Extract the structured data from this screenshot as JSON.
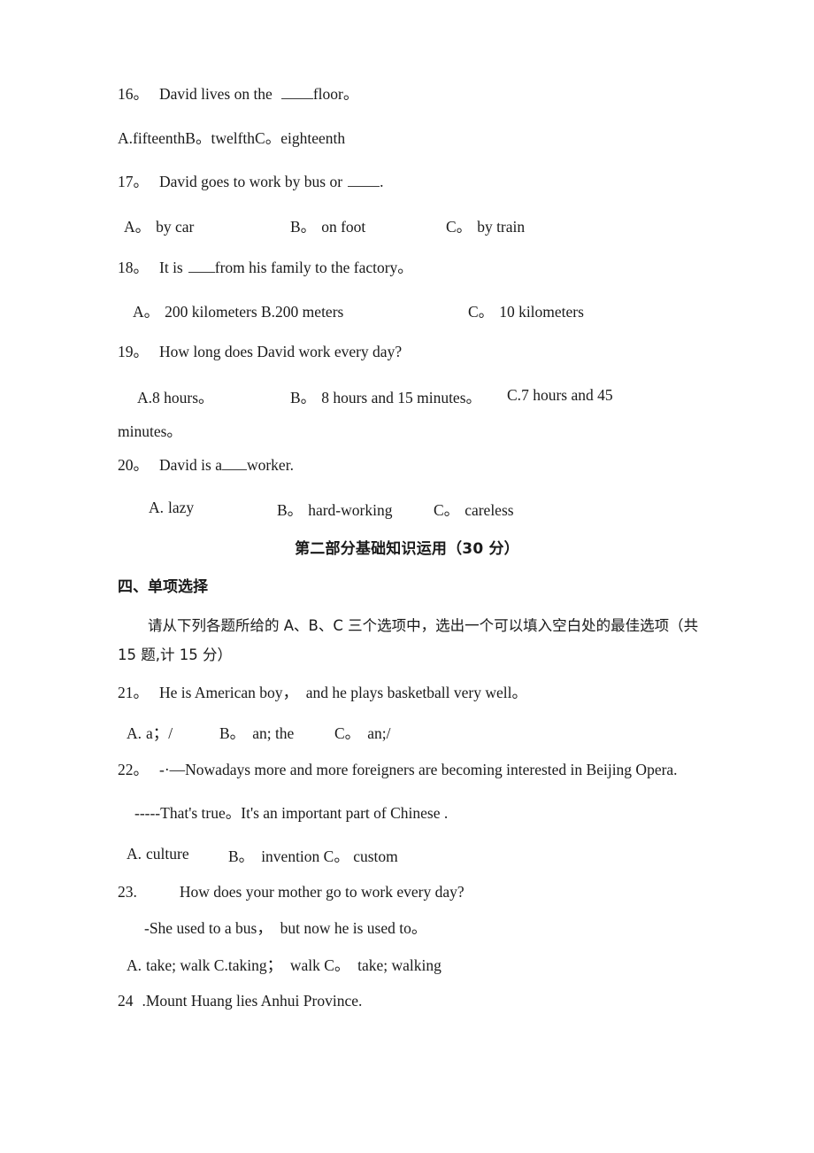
{
  "document": {
    "type": "exam-paper",
    "language": "en-zh",
    "page_background": "#ffffff",
    "text_color": "#1a1a1a"
  },
  "questions": [
    {
      "number": "16。",
      "stem_pre": "David lives on the",
      "stem_post": "floor。",
      "options_raw": "A.fifteenthB。twelfthC。eighteenth",
      "options": [
        {
          "label": "A.",
          "text": "fifteenth"
        },
        {
          "label": "B。",
          "text": "twelfth"
        },
        {
          "label": "C。",
          "text": "eighteenth"
        }
      ]
    },
    {
      "number": "17。",
      "stem_pre": "David goes to work by bus or",
      "stem_post": ".",
      "options": [
        {
          "label": "A。",
          "text": "by car"
        },
        {
          "label": "B。",
          "text": "on foot"
        },
        {
          "label": "C。",
          "text": "by train"
        }
      ]
    },
    {
      "number": "18。",
      "stem_pre": "It is",
      "stem_post": "from his family to the factory。",
      "options": [
        {
          "label": "A。",
          "text": "200 kilometers B.200 meters"
        },
        {
          "label": "C。",
          "text": "10 kilometers"
        }
      ]
    },
    {
      "number": "19。",
      "stem": "How long does David work every day?",
      "options": [
        {
          "label": "A.",
          "text": "8 hours。"
        },
        {
          "label": "B。",
          "text": "8 hours and 15 minutes。"
        },
        {
          "label": "C.",
          "text": "7 hours and 45"
        }
      ],
      "options_wrap": "minutes。"
    },
    {
      "number": "20。",
      "stem_pre": "David is a",
      "stem_post": "worker.",
      "options": [
        {
          "label": "A.",
          "text": "lazy"
        },
        {
          "label": "B。",
          "text": "hard-working"
        },
        {
          "label": "C。",
          "text": "careless"
        }
      ]
    },
    {
      "number": "21。",
      "stem": "He is American boy，  and he plays basketball very well。",
      "options": [
        {
          "label": "A.",
          "text": "a；/"
        },
        {
          "label": "B。",
          "text": "an; the"
        },
        {
          "label": "C。",
          "text": "an;/"
        }
      ]
    },
    {
      "number": "22。",
      "stem": "-·—Nowadays more and more foreigners are becoming interested in Beijing Opera.",
      "stem_line2": "-----That's true。It's an important part of Chinese .",
      "options": [
        {
          "label": "A.",
          "text": "culture"
        },
        {
          "label": "B。",
          "text": "invention C。 custom"
        }
      ]
    },
    {
      "number": "23.",
      "stem": "How does your mother go to work every day?",
      "stem_line2": "-She used to a bus，  but now he is used to。",
      "options": [
        {
          "label": "A.",
          "text": "take; walk C.taking；  walk C。  take; walking"
        }
      ]
    },
    {
      "number": "24",
      "stem": ".Mount Huang lies Anhui Province."
    }
  ],
  "section": {
    "part_title": "第二部分基础知识运用（30 分）",
    "sub_title": "四、单项选择",
    "instruction_line1": "请从下列各题所给的 A、B、C 三个选项中，选出一个可以填入空白处的最佳选项（共",
    "instruction_line2": "15 题,计 15 分）"
  }
}
